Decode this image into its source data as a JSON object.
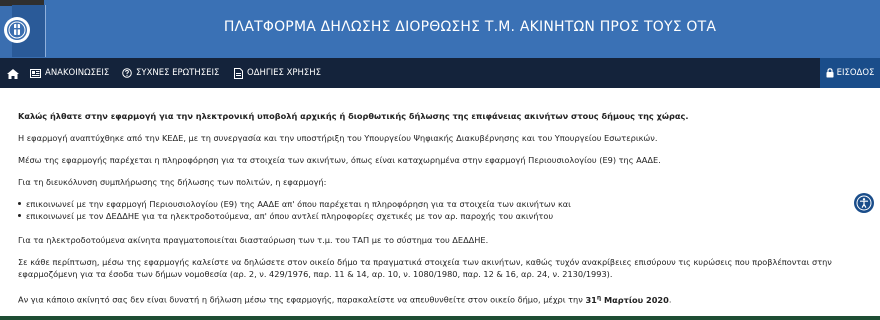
{
  "header": {
    "title": "ΠΛΑΤΦΟΡΜΑ ΔΗΛΩΣΗΣ ΔΙΟΡΘΩΣΗΣ Τ.Μ. ΑΚΙΝΗΤΩΝ ΠΡΟΣ ΤΟΥΣ ΟΤΑ",
    "logo_icon": "greek-emblem-icon",
    "color": "#3a71b5"
  },
  "nav": {
    "home_icon": "home-icon",
    "items": [
      {
        "label": "ΑΝΑΚΟΙΝΩΣΕΙΣ",
        "icon": "newspaper-icon"
      },
      {
        "label": "ΣΥΧΝΕΣ ΕΡΩΤΗΣΕΙΣ",
        "icon": "question-circle-icon"
      },
      {
        "label": "ΟΔΗΓΙΕΣ ΧΡΗΣΗΣ",
        "icon": "document-icon"
      }
    ],
    "login_label": "ΕΙΣΟΔΟΣ",
    "login_icon": "lock-icon",
    "color": "#14233b"
  },
  "content": {
    "intro": "Καλώς ήλθατε στην εφαρμογή για την ηλεκτρονική υποβολή αρχικής ή διορθωτικής δήλωσης της επιφάνειας ακινήτων στους δήμους της χώρας.",
    "p1": "Η εφαρμογή αναπτύχθηκε από την ΚΕΔΕ, με τη συνεργασία και την υποστήριξη του Υπουργείου Ψηφιακής Διακυβέρνησης και του Υπουργείου Εσωτερικών.",
    "p2": "Μέσω της εφαρμογής παρέχεται η πληροφόρηση για τα στοιχεία των ακινήτων, όπως είναι καταχωρημένα στην εφαρμογή Περιουσιολογίου (Ε9) της ΑΑΔΕ.",
    "p3": "Για τη διευκόλυνση συμπλήρωσης της δήλωσης των πολιτών, η εφαρμογή:",
    "bullets": [
      "επικοινωνεί με την εφαρμογή Περιουσιολογίου (Ε9) της ΑΑΔΕ απ' όπου παρέχεται η πληροφόρηση για τα στοιχεία των ακινήτων και",
      "επικοινωνεί με τον ΔΕΔΔΗΕ για τα ηλεκτροδοτούμενα, απ' όπου αντλεί πληροφορίες σχετικές με τον αρ. παροχής του ακινήτου"
    ],
    "p4": "Για τα ηλεκτροδοτούμενα ακίνητα πραγματοποιείται διασταύρωση των τ.μ. του ΤΑΠ με το σύστημα του ΔΕΔΔΗΕ.",
    "p5": "Σε κάθε περίπτωση, μέσω της εφαρμογής καλείστε να δηλώσετε στον οικείο δήμο τα πραγματικά στοιχεία των ακινήτων, καθώς τυχόν ανακρίβειες επισύρουν τις κυρώσεις που προβλέπονται στην εφαρμοζόμενη για τα έσοδα των δήμων νομοθεσία (αρ. 2, ν. 429/1976, παρ. 11 & 14, αρ. 10, ν. 1080/1980, παρ. 12 & 16, αρ. 24, ν. 2130/1993).",
    "p6_before": "Αν για κάποιο ακίνητό σας δεν είναι δυνατή η δήλωση μέσω της εφαρμογής, παρακαλείστε να απευθυνθείτε στον οικείο δήμο, μέχρι την ",
    "p6_deadline": "31",
    "p6_sup": "η",
    "p6_month": " Μαρτίου 2020",
    "p6_after": "."
  },
  "accessibility_icon": "accessibility-icon"
}
